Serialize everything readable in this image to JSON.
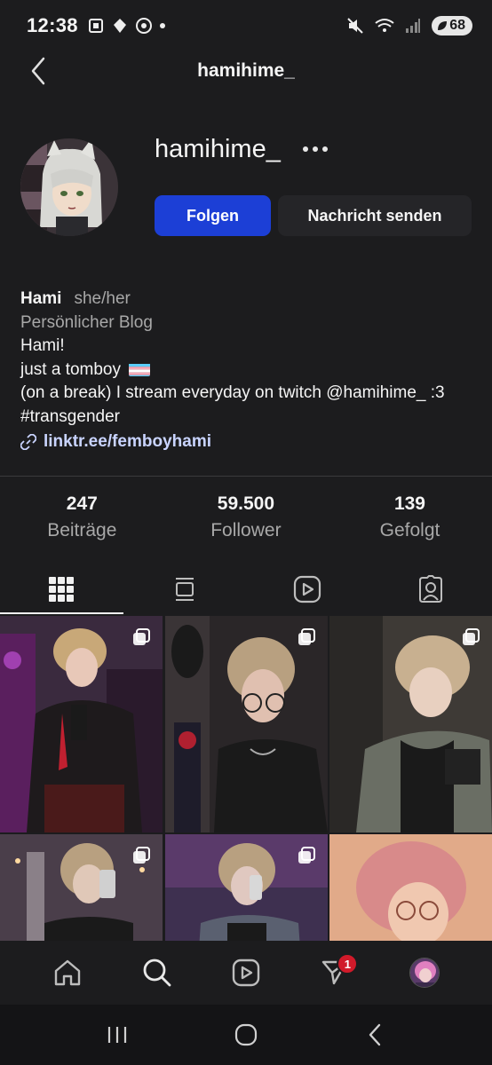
{
  "status_bar": {
    "time": "12:38",
    "battery": "68"
  },
  "header": {
    "title": "hamihime_"
  },
  "profile": {
    "username": "hamihime_",
    "follow_label": "Folgen",
    "message_label": "Nachricht senden"
  },
  "bio": {
    "name": "Hami",
    "pronouns": "she/her",
    "category": "Persönlicher Blog",
    "line1": "Hami!",
    "line2": "just a tomboy",
    "line3": "(on a break) I stream everyday on twitch @hamihime_ :3",
    "line4": "#transgender",
    "link": "linktr.ee/femboyhami"
  },
  "stats": [
    {
      "value": "247",
      "label": "Beiträge"
    },
    {
      "value": "59.500",
      "label": "Follower"
    },
    {
      "value": "139",
      "label": "Gefolgt"
    }
  ],
  "tabs": [
    "grid-icon",
    "feed-icon",
    "reels-icon",
    "tagged-icon"
  ],
  "nav": {
    "notification_count": "1"
  },
  "colors": {
    "accent": "#1c3fd6",
    "background": "#1c1c1e",
    "badge": "#d11a2a",
    "link": "#c9d4ff"
  }
}
